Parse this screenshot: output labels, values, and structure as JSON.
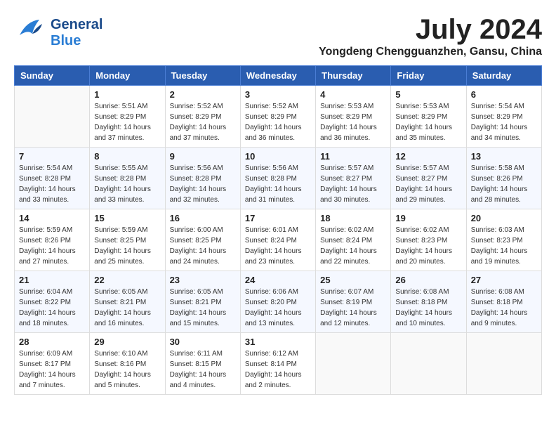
{
  "header": {
    "logo_line1": "General",
    "logo_line2": "Blue",
    "month_year": "July 2024",
    "location": "Yongdeng Chengguanzhen, Gansu, China"
  },
  "weekdays": [
    "Sunday",
    "Monday",
    "Tuesday",
    "Wednesday",
    "Thursday",
    "Friday",
    "Saturday"
  ],
  "weeks": [
    [
      {
        "day": "",
        "info": ""
      },
      {
        "day": "1",
        "info": "Sunrise: 5:51 AM\nSunset: 8:29 PM\nDaylight: 14 hours\nand 37 minutes."
      },
      {
        "day": "2",
        "info": "Sunrise: 5:52 AM\nSunset: 8:29 PM\nDaylight: 14 hours\nand 37 minutes."
      },
      {
        "day": "3",
        "info": "Sunrise: 5:52 AM\nSunset: 8:29 PM\nDaylight: 14 hours\nand 36 minutes."
      },
      {
        "day": "4",
        "info": "Sunrise: 5:53 AM\nSunset: 8:29 PM\nDaylight: 14 hours\nand 36 minutes."
      },
      {
        "day": "5",
        "info": "Sunrise: 5:53 AM\nSunset: 8:29 PM\nDaylight: 14 hours\nand 35 minutes."
      },
      {
        "day": "6",
        "info": "Sunrise: 5:54 AM\nSunset: 8:29 PM\nDaylight: 14 hours\nand 34 minutes."
      }
    ],
    [
      {
        "day": "7",
        "info": "Sunrise: 5:54 AM\nSunset: 8:28 PM\nDaylight: 14 hours\nand 33 minutes."
      },
      {
        "day": "8",
        "info": "Sunrise: 5:55 AM\nSunset: 8:28 PM\nDaylight: 14 hours\nand 33 minutes."
      },
      {
        "day": "9",
        "info": "Sunrise: 5:56 AM\nSunset: 8:28 PM\nDaylight: 14 hours\nand 32 minutes."
      },
      {
        "day": "10",
        "info": "Sunrise: 5:56 AM\nSunset: 8:28 PM\nDaylight: 14 hours\nand 31 minutes."
      },
      {
        "day": "11",
        "info": "Sunrise: 5:57 AM\nSunset: 8:27 PM\nDaylight: 14 hours\nand 30 minutes."
      },
      {
        "day": "12",
        "info": "Sunrise: 5:57 AM\nSunset: 8:27 PM\nDaylight: 14 hours\nand 29 minutes."
      },
      {
        "day": "13",
        "info": "Sunrise: 5:58 AM\nSunset: 8:26 PM\nDaylight: 14 hours\nand 28 minutes."
      }
    ],
    [
      {
        "day": "14",
        "info": "Sunrise: 5:59 AM\nSunset: 8:26 PM\nDaylight: 14 hours\nand 27 minutes."
      },
      {
        "day": "15",
        "info": "Sunrise: 5:59 AM\nSunset: 8:25 PM\nDaylight: 14 hours\nand 25 minutes."
      },
      {
        "day": "16",
        "info": "Sunrise: 6:00 AM\nSunset: 8:25 PM\nDaylight: 14 hours\nand 24 minutes."
      },
      {
        "day": "17",
        "info": "Sunrise: 6:01 AM\nSunset: 8:24 PM\nDaylight: 14 hours\nand 23 minutes."
      },
      {
        "day": "18",
        "info": "Sunrise: 6:02 AM\nSunset: 8:24 PM\nDaylight: 14 hours\nand 22 minutes."
      },
      {
        "day": "19",
        "info": "Sunrise: 6:02 AM\nSunset: 8:23 PM\nDaylight: 14 hours\nand 20 minutes."
      },
      {
        "day": "20",
        "info": "Sunrise: 6:03 AM\nSunset: 8:23 PM\nDaylight: 14 hours\nand 19 minutes."
      }
    ],
    [
      {
        "day": "21",
        "info": "Sunrise: 6:04 AM\nSunset: 8:22 PM\nDaylight: 14 hours\nand 18 minutes."
      },
      {
        "day": "22",
        "info": "Sunrise: 6:05 AM\nSunset: 8:21 PM\nDaylight: 14 hours\nand 16 minutes."
      },
      {
        "day": "23",
        "info": "Sunrise: 6:05 AM\nSunset: 8:21 PM\nDaylight: 14 hours\nand 15 minutes."
      },
      {
        "day": "24",
        "info": "Sunrise: 6:06 AM\nSunset: 8:20 PM\nDaylight: 14 hours\nand 13 minutes."
      },
      {
        "day": "25",
        "info": "Sunrise: 6:07 AM\nSunset: 8:19 PM\nDaylight: 14 hours\nand 12 minutes."
      },
      {
        "day": "26",
        "info": "Sunrise: 6:08 AM\nSunset: 8:18 PM\nDaylight: 14 hours\nand 10 minutes."
      },
      {
        "day": "27",
        "info": "Sunrise: 6:08 AM\nSunset: 8:18 PM\nDaylight: 14 hours\nand 9 minutes."
      }
    ],
    [
      {
        "day": "28",
        "info": "Sunrise: 6:09 AM\nSunset: 8:17 PM\nDaylight: 14 hours\nand 7 minutes."
      },
      {
        "day": "29",
        "info": "Sunrise: 6:10 AM\nSunset: 8:16 PM\nDaylight: 14 hours\nand 5 minutes."
      },
      {
        "day": "30",
        "info": "Sunrise: 6:11 AM\nSunset: 8:15 PM\nDaylight: 14 hours\nand 4 minutes."
      },
      {
        "day": "31",
        "info": "Sunrise: 6:12 AM\nSunset: 8:14 PM\nDaylight: 14 hours\nand 2 minutes."
      },
      {
        "day": "",
        "info": ""
      },
      {
        "day": "",
        "info": ""
      },
      {
        "day": "",
        "info": ""
      }
    ]
  ]
}
